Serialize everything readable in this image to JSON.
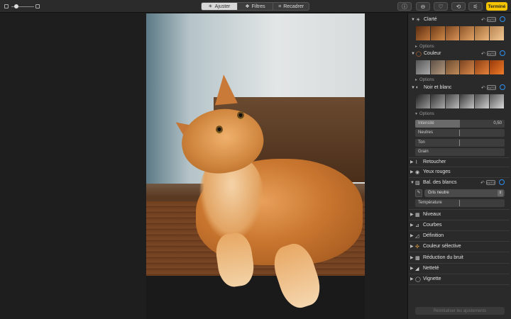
{
  "toolbar": {
    "tabs": [
      {
        "label": "Ajuster",
        "icon": "sun-icon",
        "active": true
      },
      {
        "label": "Filtres",
        "icon": "filters-icon",
        "active": false
      },
      {
        "label": "Recadrer",
        "icon": "crop-icon",
        "active": false
      }
    ],
    "done_label": "Terminé",
    "accent_color": "#f5c400"
  },
  "sidebar": {
    "clarte": {
      "title": "Clarté",
      "auto": "AUTO",
      "options": "Options"
    },
    "couleur": {
      "title": "Couleur",
      "auto": "AUTO",
      "options": "Options"
    },
    "noir_blanc": {
      "title": "Noir et blanc",
      "auto": "AUTO",
      "options": "Options",
      "sliders": [
        {
          "label": "Intensité",
          "value": "0,50",
          "level": 0.5
        },
        {
          "label": "Neutres",
          "value": ""
        },
        {
          "label": "Ton",
          "value": ""
        },
        {
          "label": "Grain",
          "value": ""
        }
      ]
    },
    "retoucher": "Retoucher",
    "yeux_rouges": "Yeux rouges",
    "bal_blancs": {
      "title": "Bal. des blancs",
      "auto": "AUTO",
      "mode": "Gris neutre",
      "temperature": "Température"
    },
    "items": [
      "Niveaux",
      "Courbes",
      "Définition",
      "Couleur sélective",
      "Réduction du bruit",
      "Netteté",
      "Vignette"
    ],
    "reset_label": "Réinitialiser les ajustements",
    "toggle_color": "#2f8ff0"
  }
}
